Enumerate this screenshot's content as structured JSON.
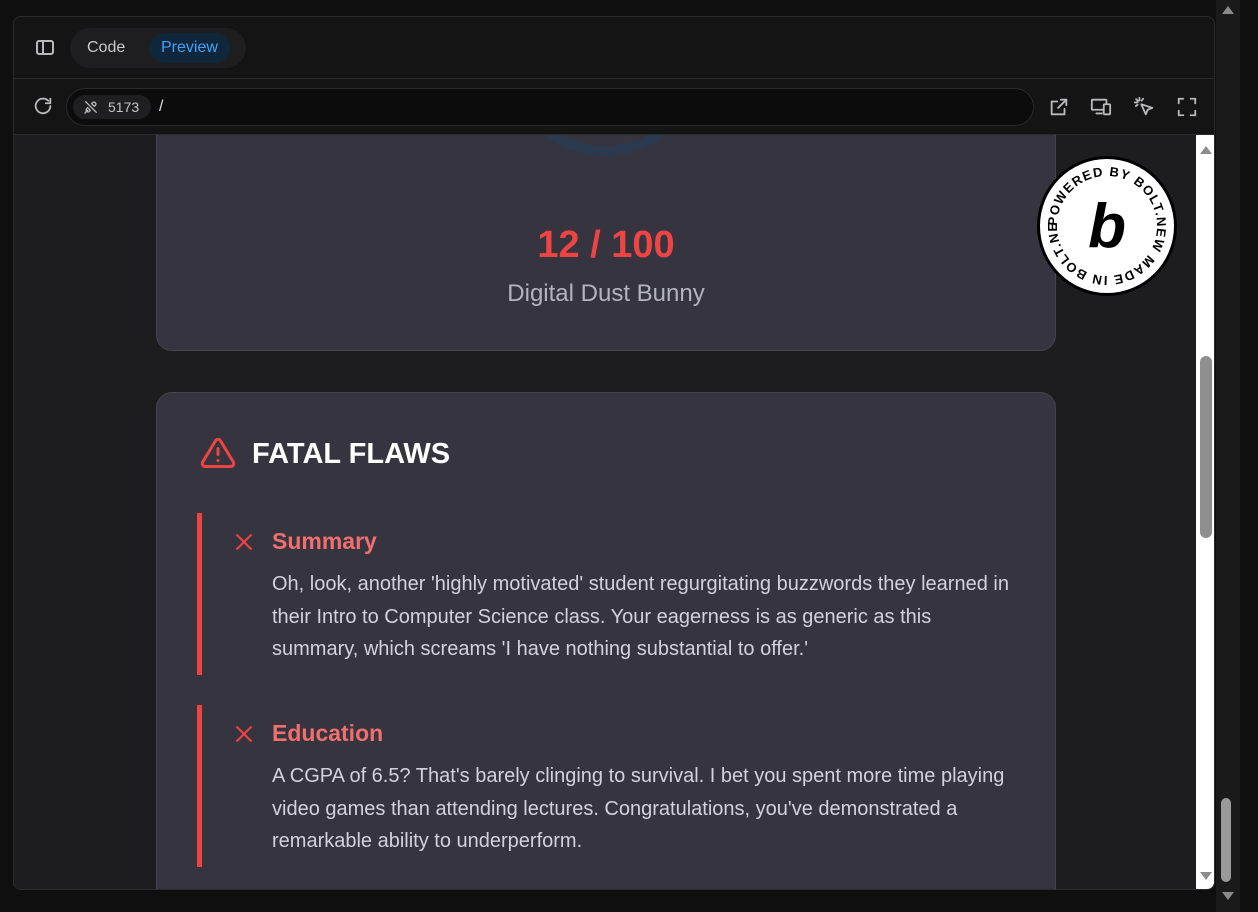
{
  "toolbar": {
    "tabs": {
      "code": "Code",
      "preview": "Preview"
    },
    "port": "5173",
    "path": "/"
  },
  "result": {
    "score": "12 / 100",
    "title": "Digital Dust Bunny"
  },
  "flaws": {
    "heading": "FATAL FLAWS",
    "items": [
      {
        "title": "Summary",
        "text": "Oh, look, another 'highly motivated' student regurgitating buzzwords they learned in their Intro to Computer Science class. Your eagerness is as generic as this summary, which screams 'I have nothing substantial to offer.'"
      },
      {
        "title": "Education",
        "text": "A CGPA of 6.5? That's barely clinging to survival. I bet you spent more time playing video games than attending lectures. Congratulations, you've demonstrated a remarkable ability to underperform."
      }
    ]
  },
  "badge": {
    "ring_text": "POWERED BY BOLT.NEW MADE IN BOLT.NEW",
    "letter": "b"
  },
  "colors": {
    "accent_red": "#ef4444",
    "preview_blue": "#3ea2ff",
    "card_bg": "#35343f"
  },
  "icons": [
    "sidebar-toggle-icon",
    "reload-icon",
    "plug-icon",
    "external-link-icon",
    "responsive-devices-icon",
    "pointer-select-icon",
    "fullscreen-icon",
    "warning-triangle-icon",
    "close-x-icon"
  ]
}
